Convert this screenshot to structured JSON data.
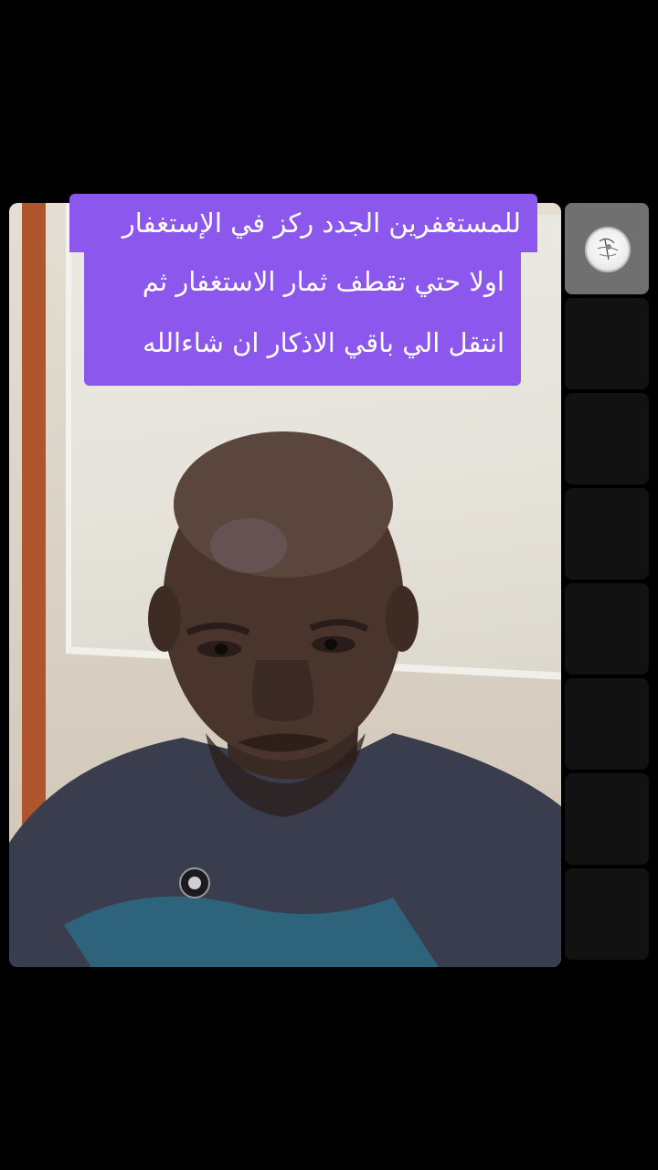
{
  "caption": {
    "line1": "للمستغفرين الجدد ركز في الإستغفار",
    "line2": "اولا حتي تقطف ثمار الاستغفار ثم",
    "line3": "انتقل الي باقي الاذكار ان شاءالله"
  },
  "colors": {
    "background": "#000000",
    "caption_background": "#8b57ec",
    "caption_text": "#ffffff",
    "tile_empty": "#121212",
    "tile_active": "#707070"
  },
  "participant_tiles": [
    {
      "state": "active",
      "icon": "profile-avatar-icon"
    },
    {
      "state": "empty"
    },
    {
      "state": "empty"
    },
    {
      "state": "empty"
    },
    {
      "state": "empty"
    },
    {
      "state": "empty"
    },
    {
      "state": "empty"
    },
    {
      "state": "empty"
    }
  ]
}
